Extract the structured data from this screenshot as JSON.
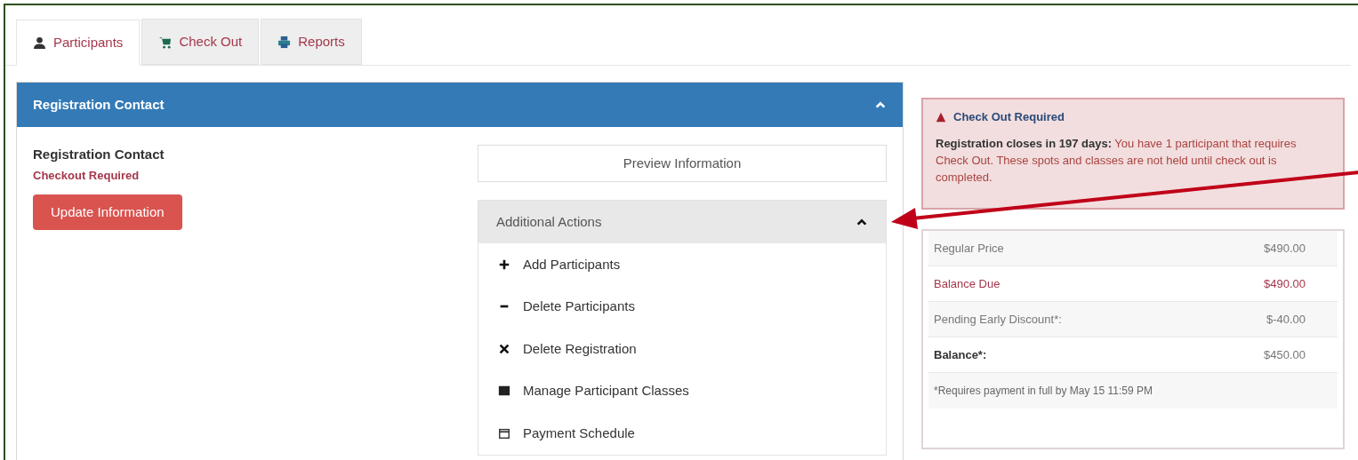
{
  "tabs": [
    {
      "label": "Participants",
      "selected": true
    },
    {
      "label": "Check Out",
      "selected": false
    },
    {
      "label": "Reports",
      "selected": false
    }
  ],
  "contact_panel": {
    "title": "Registration Contact",
    "expanded": true,
    "contact": {
      "heading": "Registration Contact",
      "status": "Checkout Required",
      "button": "Update Information"
    },
    "preview_button": "Preview Information",
    "additional_actions": {
      "title": "Additional Actions",
      "expanded": true,
      "items": [
        {
          "label": "Add Participants"
        },
        {
          "label": "Delete Participants"
        },
        {
          "label": "Delete Registration"
        },
        {
          "label": "Manage Participant Classes"
        },
        {
          "label": "Payment Schedule"
        }
      ]
    }
  },
  "alert": {
    "title": "Check Out Required",
    "message": "**Registration closes in 197 days:** You have 1 participant that requires Check Out. These spots and classes are not held until check out is completed."
  },
  "price_summary": {
    "rows": [
      {
        "label": "Regular Price",
        "value": "$490.00",
        "kind": "normal"
      },
      {
        "label": "Balance Due",
        "value": "$490.00",
        "kind": "due"
      },
      {
        "label": "Pending Early Discount*:",
        "value": "$-40.00",
        "kind": "normal"
      },
      {
        "label": "Balance*:",
        "value": "$450.00",
        "kind": "total"
      }
    ],
    "note": "*Requires payment in full by May 15 11:59 PM"
  }
}
